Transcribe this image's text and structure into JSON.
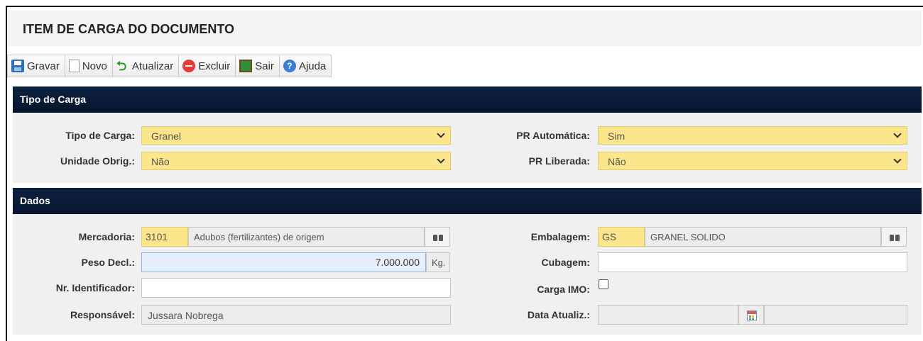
{
  "page": {
    "title": "ITEM DE CARGA DO DOCUMENTO"
  },
  "toolbar": {
    "save_label": "Gravar",
    "new_label": "Novo",
    "refresh_label": "Atualizar",
    "delete_label": "Excluir",
    "exit_label": "Sair",
    "help_label": "Ajuda"
  },
  "icons": {
    "save": "save-icon",
    "new": "new-document-icon",
    "refresh": "refresh-icon",
    "delete": "delete-icon",
    "exit": "exit-door-icon",
    "help": "help-icon",
    "lookup": "binoculars-icon",
    "calendar": "calendar-icon",
    "dropdown": "chevron-down-icon"
  },
  "colors": {
    "section_header": "#0b1d3a",
    "required_field": "#fce68c",
    "focused_field": "#e6f0fc"
  },
  "tipo_carga_section": {
    "header": "Tipo de Carga",
    "tipo_carga": {
      "label": "Tipo de Carga:",
      "value": "Granel"
    },
    "unidade_obrig": {
      "label": "Unidade Obrig.:",
      "value": "Não"
    },
    "pr_automatica": {
      "label": "PR Automática:",
      "value": "Sim"
    },
    "pr_liberada": {
      "label": "PR Liberada:",
      "value": "Não"
    }
  },
  "dados_section": {
    "header": "Dados",
    "mercadoria": {
      "label": "Mercadoria:",
      "code": "3101",
      "description": "Adubos (fertilizantes) de origem"
    },
    "peso_decl": {
      "label": "Peso Decl.:",
      "value": "7.000.000",
      "unit": "Kg."
    },
    "nr_identificador": {
      "label": "Nr. Identificador:",
      "value": ""
    },
    "responsavel": {
      "label": "Responsável:",
      "value": "Jussara Nobrega"
    },
    "embalagem": {
      "label": "Embalagem:",
      "code": "GS",
      "description": "GRANEL SOLIDO"
    },
    "cubagem": {
      "label": "Cubagem:",
      "value": ""
    },
    "carga_imo": {
      "label": "Carga IMO:",
      "checked": false
    },
    "data_atualiz": {
      "label": "Data Atualiz.:",
      "date": "",
      "time": ""
    }
  }
}
